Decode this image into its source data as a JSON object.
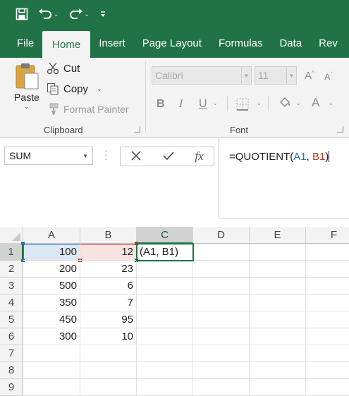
{
  "qat": {
    "icons": [
      "save-icon",
      "undo-icon",
      "redo-icon",
      "customize-qat-icon"
    ]
  },
  "tabs": [
    {
      "label": "File",
      "active": false
    },
    {
      "label": "Home",
      "active": true
    },
    {
      "label": "Insert",
      "active": false
    },
    {
      "label": "Page Layout",
      "active": false
    },
    {
      "label": "Formulas",
      "active": false
    },
    {
      "label": "Data",
      "active": false
    },
    {
      "label": "Rev",
      "active": false
    }
  ],
  "ribbon": {
    "clipboard": {
      "paste": "Paste",
      "cut": "Cut",
      "copy": "Copy",
      "format_painter": "Format Painter",
      "group_label": "Clipboard"
    },
    "font": {
      "font_name": "Calibri",
      "font_size": "11",
      "bold": "B",
      "italic": "I",
      "underline": "U",
      "font_color": "A",
      "grow": "A",
      "shrink": "A",
      "group_label": "Font"
    }
  },
  "formula_bar": {
    "name_box": "SUM",
    "fx": "fx",
    "formula_prefix": "=QUOTIENT(",
    "ref_a": "A1",
    "sep": ", ",
    "ref_b": "B1",
    "formula_suffix": ")"
  },
  "grid": {
    "columns": [
      "A",
      "B",
      "C",
      "D",
      "E",
      "F"
    ],
    "rows": [
      "1",
      "2",
      "3",
      "4",
      "5",
      "6",
      "7",
      "8",
      "9"
    ],
    "cells": {
      "A1": "100",
      "B1": "12",
      "C1": "(A1, B1)",
      "A2": "200",
      "B2": "23",
      "A3": "500",
      "B3": "6",
      "A4": "350",
      "B4": "7",
      "A5": "450",
      "B5": "95",
      "A6": "300",
      "B6": "10"
    },
    "active_cell": "C1",
    "active_column": "C",
    "active_row": "1"
  },
  "colors": {
    "brand": "#217346",
    "ref_a": "#2f6fb5",
    "ref_b": "#c0392b"
  }
}
